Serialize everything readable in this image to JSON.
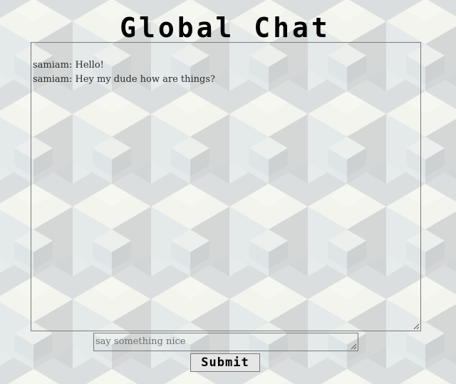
{
  "page": {
    "title": "Global Chat"
  },
  "chat": {
    "messages": [
      {
        "text": "samiam: Hello!"
      },
      {
        "text": "samiam: Hey my dude how are things?"
      }
    ]
  },
  "input": {
    "placeholder": "say something nice"
  },
  "submit": {
    "label": "Submit"
  },
  "colors": {
    "background": "#e8eaea",
    "cube_light": "#fbfbf2",
    "cube_blue": "#dfe9ea",
    "cube_gray": "#cdd1d1",
    "text": "#000000"
  }
}
